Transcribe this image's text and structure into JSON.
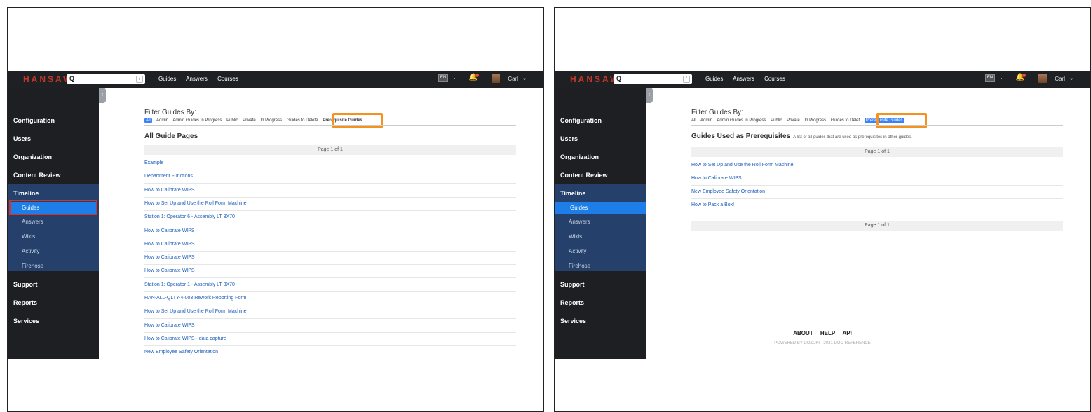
{
  "shared": {
    "logo": "HANSAW",
    "nav": [
      "Guides",
      "Answers",
      "Courses"
    ],
    "lang": "EN",
    "user": "Carl",
    "sidebar_top": [
      "Configuration",
      "Users",
      "Organization",
      "Content Review",
      "Timeline"
    ],
    "sidebar_sub": [
      "Guides",
      "Answers",
      "Wikis",
      "Activity",
      "Firehose"
    ],
    "sidebar_bottom": [
      "Support",
      "Reports",
      "Services"
    ],
    "filter_title": "Filter Guides By:",
    "filters": [
      "All",
      "Admin",
      "Admin Guides In Progress",
      "Public",
      "Private",
      "In Progress",
      "Guides to Delete",
      "Prerequisite Guides"
    ],
    "filters_right": [
      "All",
      "Admin",
      "Admin Guides In Progress",
      "Public",
      "Private",
      "In Progress",
      "Guides to Delet",
      "Prerequisite Guides"
    ],
    "pager": "Page 1 of 1"
  },
  "left": {
    "section_title": "All Guide Pages",
    "rows": [
      "Example",
      "Department Functions",
      "How to Calibrate WIPS",
      "How to Set Up and Use the Roll Form Machine",
      "Station 1: Operator 6 - Assembly LT 3X70",
      "How to Calibrate WIPS",
      "How to Calibrate WIPS",
      "How to Calibrate WIPS",
      "How to Calibrate WIPS",
      "Station 1: Operator 1 - Assembly LT 3X70",
      "HAN-ALL-QLTY-4-003 Rework Reporting Form",
      "How to Set Up and Use the Roll Form Machine",
      "How to Calibrate WIPS",
      "How to Calibrate WIPS - data capture",
      "New Employee Safety Orientation"
    ]
  },
  "right": {
    "section_title": "Guides Used as Prerequisites",
    "section_sub": "A list of all guides that are used as prerequisites in other guides.",
    "rows": [
      "How to Set Up and Use the Roll Form Machine",
      "How to Calibrate WIPS",
      "New Employee Safety Orientation",
      "How to Pack a Box!"
    ],
    "footer_links": [
      "ABOUT",
      "HELP",
      "API"
    ],
    "footer_power": "POWERED BY DOZUKI - 2021 DOC-REFERENCE"
  },
  "colors": {
    "topbar": "#1f2023",
    "sidebar": "#1e1f22",
    "sub_block": "#24406b",
    "active": "#1c7ee6",
    "link": "#1f5fb8",
    "highlight_orange": "#f5921e",
    "highlight_red": "#d0342c"
  },
  "icons": [
    "search-icon",
    "bell-icon",
    "chevron-down-icon",
    "chevron-left-icon"
  ]
}
